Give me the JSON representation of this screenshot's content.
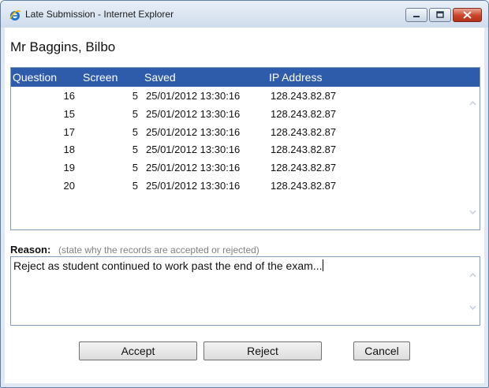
{
  "window": {
    "title": "Late Submission - Internet Explorer",
    "app_icon": "internet-explorer-icon"
  },
  "student": {
    "name": "Mr Baggins, Bilbo"
  },
  "table": {
    "headers": [
      "Question",
      "Screen",
      "Saved",
      "IP Address"
    ],
    "rows": [
      [
        "16",
        "5",
        "25/01/2012 13:30:16",
        "128.243.82.87"
      ],
      [
        "15",
        "5",
        "25/01/2012 13:30:16",
        "128.243.82.87"
      ],
      [
        "17",
        "5",
        "25/01/2012 13:30:16",
        "128.243.82.87"
      ],
      [
        "18",
        "5",
        "25/01/2012 13:30:16",
        "128.243.82.87"
      ],
      [
        "19",
        "5",
        "25/01/2012 13:30:16",
        "128.243.82.87"
      ],
      [
        "20",
        "5",
        "25/01/2012 13:30:16",
        "128.243.82.87"
      ]
    ],
    "header_color": "#2e5cab"
  },
  "reason": {
    "label": "Reason:",
    "hint": "(state why the records are accepted or rejected)",
    "value": "Reject as student continued to work past the end of the exam..."
  },
  "buttons": {
    "accept": "Accept",
    "reject": "Reject",
    "cancel": "Cancel"
  }
}
